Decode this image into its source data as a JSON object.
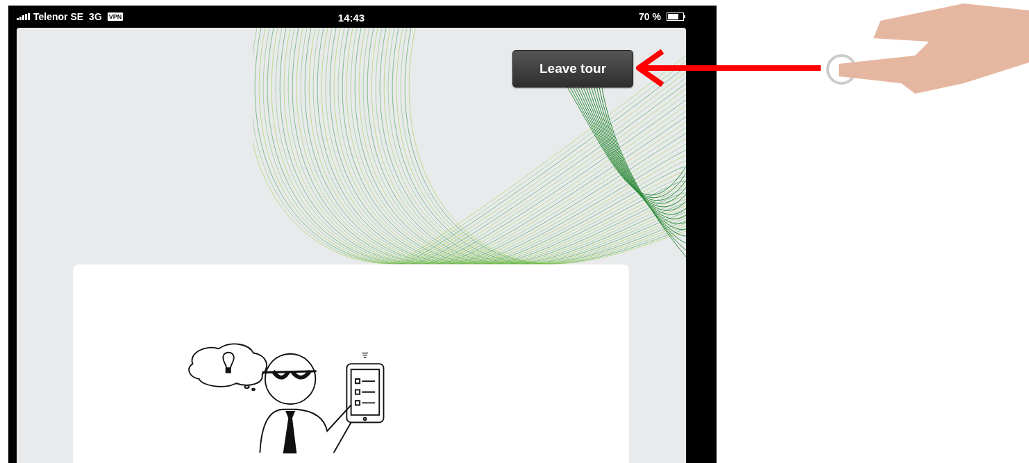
{
  "status_bar": {
    "carrier": "Telenor SE",
    "network": "3G",
    "vpn_badge": "VPN",
    "time": "14:43",
    "battery_percent": "70 %"
  },
  "leave_button": {
    "label": "Leave tour"
  }
}
